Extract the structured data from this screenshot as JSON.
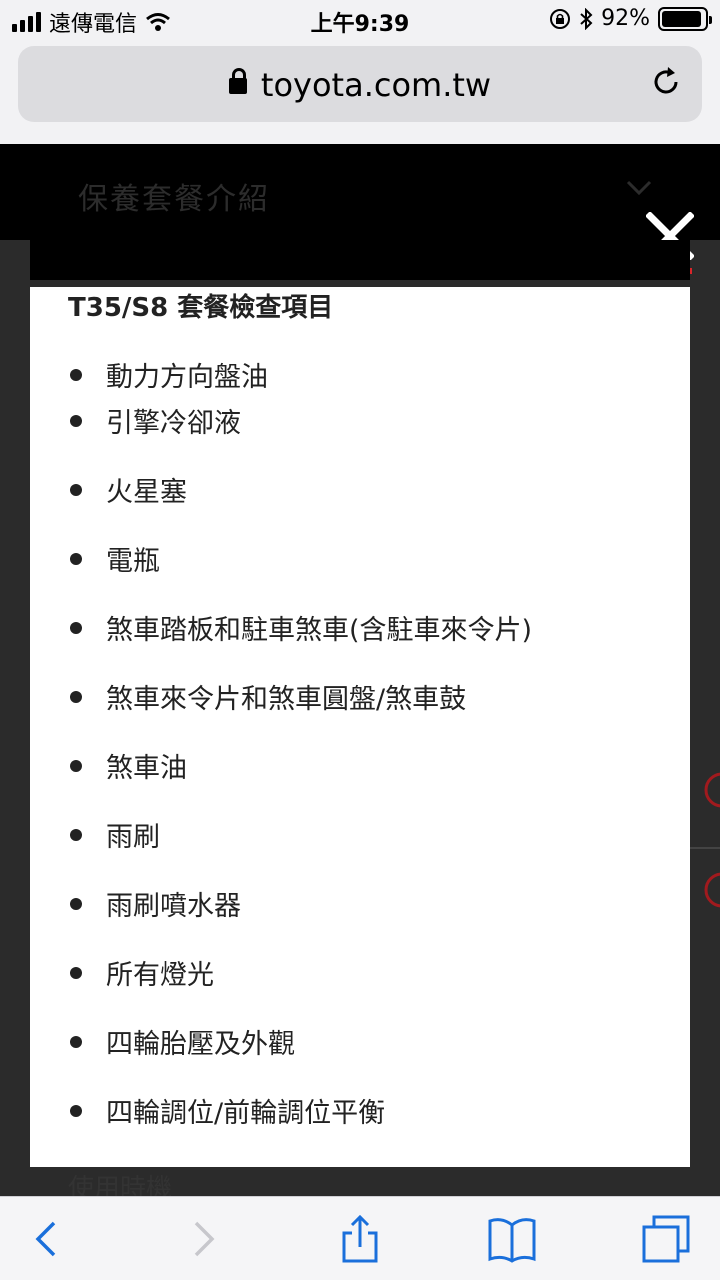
{
  "status_bar": {
    "carrier": "遠傳電信",
    "time": "上午9:39",
    "battery_percent": "92%",
    "battery_level": 0.92
  },
  "browser": {
    "url": "toyota.com.tw"
  },
  "page": {
    "section_title": "保養套餐介紹",
    "peek_text": "使用時機"
  },
  "modal": {
    "heading": "T35/S8 套餐檢查項目",
    "items": [
      "動力方向盤油",
      "引擎冷卻液",
      "火星塞",
      "電瓶",
      "煞車踏板和駐車煞車(含駐車來令片)",
      "煞車來令片和煞車圓盤/煞車鼓",
      "煞車油",
      "雨刷",
      "雨刷噴水器",
      "所有燈光",
      "四輪胎壓及外觀",
      "四輪調位/前輪調位平衡"
    ]
  },
  "colors": {
    "accent_red": "#d9252a",
    "toolbar_blue": "#1a6fdb"
  }
}
